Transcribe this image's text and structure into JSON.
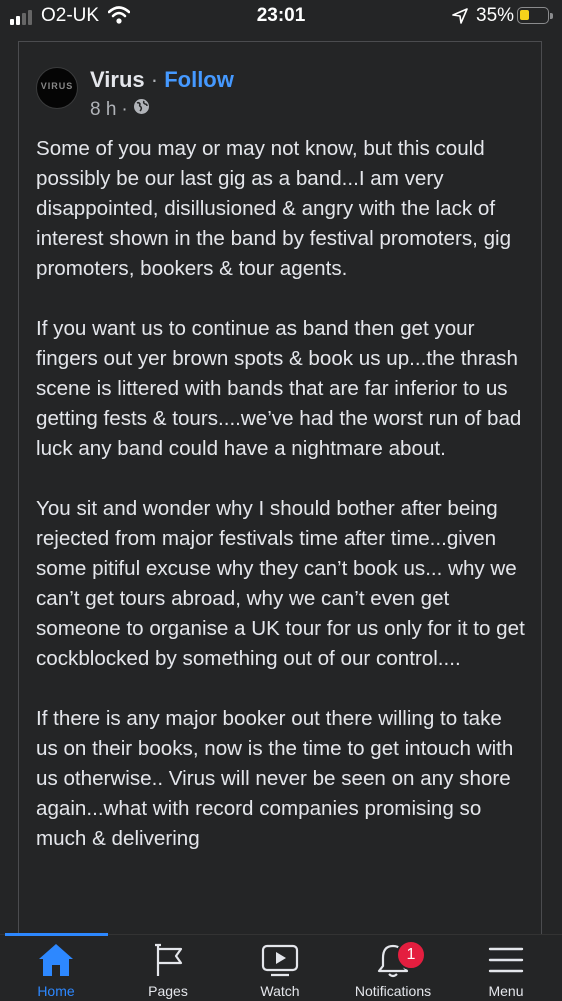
{
  "status_bar": {
    "carrier": "O2-UK",
    "time": "23:01",
    "battery_percent": "35%"
  },
  "post": {
    "author": "Virus",
    "separator": "·",
    "follow_label": "Follow",
    "time_ago": "8 h",
    "meta_separator": "·",
    "avatar_icon": "band-logo-avatar",
    "paragraphs": [
      "Some of you may or may not know, but this could possibly be our last gig as a band...I am very disappointed, disillusioned & angry with the lack of interest shown in the band by festival promoters, gig promoters, bookers & tour agents.",
      "If you want us to continue as band then get your fingers out yer brown spots & book us up...the thrash scene is littered with bands that are far inferior to us getting fests & tours....we’ve had the worst run of bad luck any band could have a nightmare about.",
      "You sit and wonder why I should bother after being rejected from major festivals time after time...given some pitiful excuse why they can’t book us... why we can’t get tours abroad, why we can’t even get someone to organise a UK tour for us only for it to get cockblocked by something out of our control....",
      "If there is any major booker out there willing to take us on their books, now is the time to get intouch with us otherwise.. Virus will never be seen on any shore again...what with record companies promising so much & delivering"
    ]
  },
  "tab_bar": {
    "tabs": [
      {
        "label": "Home",
        "icon": "home-icon",
        "active": true
      },
      {
        "label": "Pages",
        "icon": "flag-icon",
        "active": false
      },
      {
        "label": "Watch",
        "icon": "play-icon",
        "active": false
      },
      {
        "label": "Notifications",
        "icon": "bell-icon",
        "active": false
      },
      {
        "label": "Menu",
        "icon": "hamburger-icon",
        "active": false
      }
    ],
    "notifications_badge": "1"
  },
  "colors": {
    "background": "#242526",
    "accent": "#2d88ff",
    "follow": "#4599ff",
    "badge": "#e41e3f",
    "battery_low": "#f7d21b"
  }
}
